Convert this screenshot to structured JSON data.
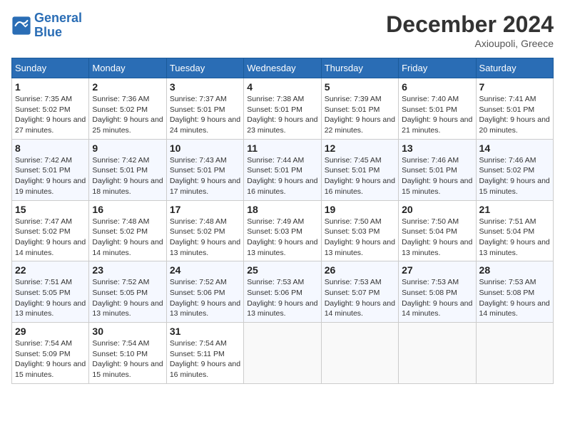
{
  "header": {
    "logo_line1": "General",
    "logo_line2": "Blue",
    "month_year": "December 2024",
    "location": "Axioupoli, Greece"
  },
  "weekdays": [
    "Sunday",
    "Monday",
    "Tuesday",
    "Wednesday",
    "Thursday",
    "Friday",
    "Saturday"
  ],
  "weeks": [
    [
      {
        "day": "1",
        "sunrise": "7:35 AM",
        "sunset": "5:02 PM",
        "daylight": "9 hours and 27 minutes."
      },
      {
        "day": "2",
        "sunrise": "7:36 AM",
        "sunset": "5:02 PM",
        "daylight": "9 hours and 25 minutes."
      },
      {
        "day": "3",
        "sunrise": "7:37 AM",
        "sunset": "5:01 PM",
        "daylight": "9 hours and 24 minutes."
      },
      {
        "day": "4",
        "sunrise": "7:38 AM",
        "sunset": "5:01 PM",
        "daylight": "9 hours and 23 minutes."
      },
      {
        "day": "5",
        "sunrise": "7:39 AM",
        "sunset": "5:01 PM",
        "daylight": "9 hours and 22 minutes."
      },
      {
        "day": "6",
        "sunrise": "7:40 AM",
        "sunset": "5:01 PM",
        "daylight": "9 hours and 21 minutes."
      },
      {
        "day": "7",
        "sunrise": "7:41 AM",
        "sunset": "5:01 PM",
        "daylight": "9 hours and 20 minutes."
      }
    ],
    [
      {
        "day": "8",
        "sunrise": "7:42 AM",
        "sunset": "5:01 PM",
        "daylight": "9 hours and 19 minutes."
      },
      {
        "day": "9",
        "sunrise": "7:42 AM",
        "sunset": "5:01 PM",
        "daylight": "9 hours and 18 minutes."
      },
      {
        "day": "10",
        "sunrise": "7:43 AM",
        "sunset": "5:01 PM",
        "daylight": "9 hours and 17 minutes."
      },
      {
        "day": "11",
        "sunrise": "7:44 AM",
        "sunset": "5:01 PM",
        "daylight": "9 hours and 16 minutes."
      },
      {
        "day": "12",
        "sunrise": "7:45 AM",
        "sunset": "5:01 PM",
        "daylight": "9 hours and 16 minutes."
      },
      {
        "day": "13",
        "sunrise": "7:46 AM",
        "sunset": "5:01 PM",
        "daylight": "9 hours and 15 minutes."
      },
      {
        "day": "14",
        "sunrise": "7:46 AM",
        "sunset": "5:02 PM",
        "daylight": "9 hours and 15 minutes."
      }
    ],
    [
      {
        "day": "15",
        "sunrise": "7:47 AM",
        "sunset": "5:02 PM",
        "daylight": "9 hours and 14 minutes."
      },
      {
        "day": "16",
        "sunrise": "7:48 AM",
        "sunset": "5:02 PM",
        "daylight": "9 hours and 14 minutes."
      },
      {
        "day": "17",
        "sunrise": "7:48 AM",
        "sunset": "5:02 PM",
        "daylight": "9 hours and 13 minutes."
      },
      {
        "day": "18",
        "sunrise": "7:49 AM",
        "sunset": "5:03 PM",
        "daylight": "9 hours and 13 minutes."
      },
      {
        "day": "19",
        "sunrise": "7:50 AM",
        "sunset": "5:03 PM",
        "daylight": "9 hours and 13 minutes."
      },
      {
        "day": "20",
        "sunrise": "7:50 AM",
        "sunset": "5:04 PM",
        "daylight": "9 hours and 13 minutes."
      },
      {
        "day": "21",
        "sunrise": "7:51 AM",
        "sunset": "5:04 PM",
        "daylight": "9 hours and 13 minutes."
      }
    ],
    [
      {
        "day": "22",
        "sunrise": "7:51 AM",
        "sunset": "5:05 PM",
        "daylight": "9 hours and 13 minutes."
      },
      {
        "day": "23",
        "sunrise": "7:52 AM",
        "sunset": "5:05 PM",
        "daylight": "9 hours and 13 minutes."
      },
      {
        "day": "24",
        "sunrise": "7:52 AM",
        "sunset": "5:06 PM",
        "daylight": "9 hours and 13 minutes."
      },
      {
        "day": "25",
        "sunrise": "7:53 AM",
        "sunset": "5:06 PM",
        "daylight": "9 hours and 13 minutes."
      },
      {
        "day": "26",
        "sunrise": "7:53 AM",
        "sunset": "5:07 PM",
        "daylight": "9 hours and 14 minutes."
      },
      {
        "day": "27",
        "sunrise": "7:53 AM",
        "sunset": "5:08 PM",
        "daylight": "9 hours and 14 minutes."
      },
      {
        "day": "28",
        "sunrise": "7:53 AM",
        "sunset": "5:08 PM",
        "daylight": "9 hours and 14 minutes."
      }
    ],
    [
      {
        "day": "29",
        "sunrise": "7:54 AM",
        "sunset": "5:09 PM",
        "daylight": "9 hours and 15 minutes."
      },
      {
        "day": "30",
        "sunrise": "7:54 AM",
        "sunset": "5:10 PM",
        "daylight": "9 hours and 15 minutes."
      },
      {
        "day": "31",
        "sunrise": "7:54 AM",
        "sunset": "5:11 PM",
        "daylight": "9 hours and 16 minutes."
      },
      null,
      null,
      null,
      null
    ]
  ]
}
